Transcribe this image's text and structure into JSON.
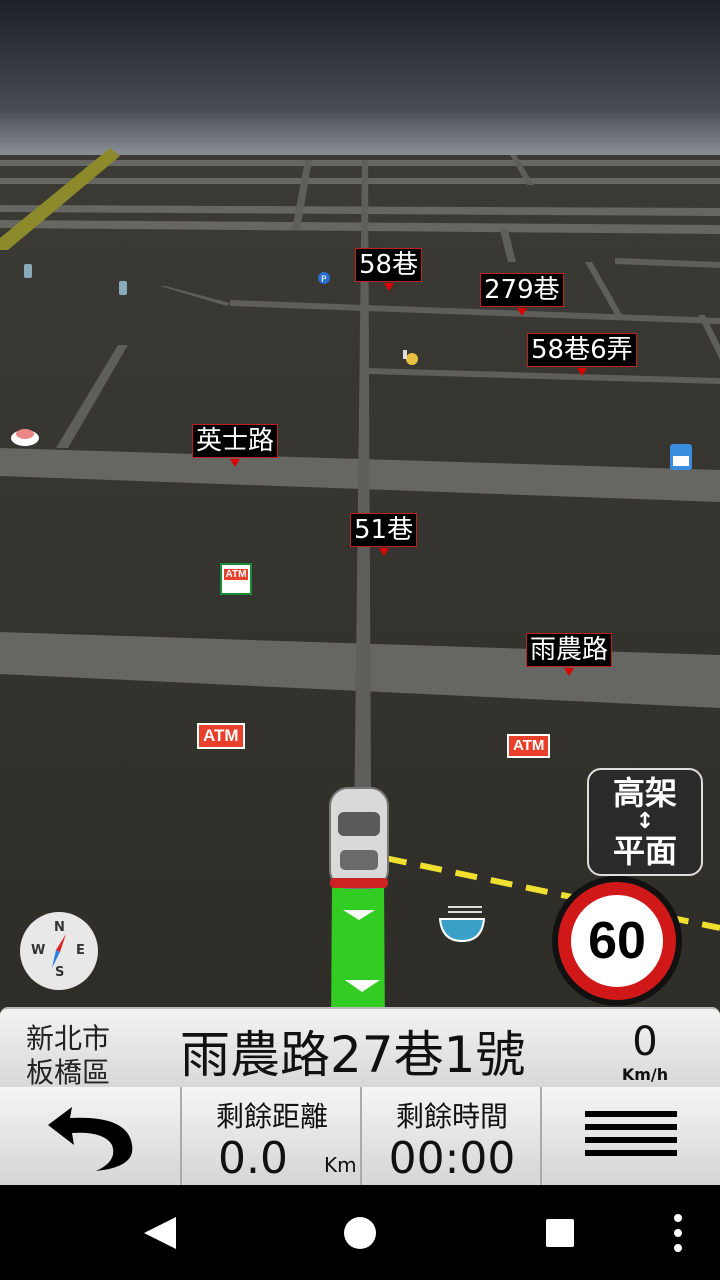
{
  "map": {
    "street_labels": [
      "58巷",
      "279巷",
      "58巷6弄",
      "英士路",
      "51巷",
      "雨農路"
    ],
    "poi_icons": [
      "parking-icon",
      "atm-icon",
      "restaurant-icon",
      "noodle-icon",
      "store-icon"
    ],
    "atm_text": "ATM"
  },
  "controls": {
    "elevated_toggle": {
      "top": "高架",
      "arrow": "↕",
      "bottom": "平面"
    },
    "compass": {
      "n": "N",
      "s": "S",
      "e": "E",
      "w": "W"
    },
    "speed_limit": "60"
  },
  "address_bar": {
    "city": "新北市",
    "district": "板橋區",
    "street": "雨農路27巷1號",
    "speed_value": "0",
    "speed_unit": "Km/h"
  },
  "bottom_bar": {
    "remaining_distance_label": "剩餘距離",
    "remaining_distance_value": "0.0",
    "distance_unit": "Km",
    "remaining_time_label": "剩餘時間",
    "remaining_time_value": "00:00"
  },
  "colors": {
    "route": "#33cc22",
    "speed_ring": "#d01818",
    "label_border": "#b22222"
  }
}
